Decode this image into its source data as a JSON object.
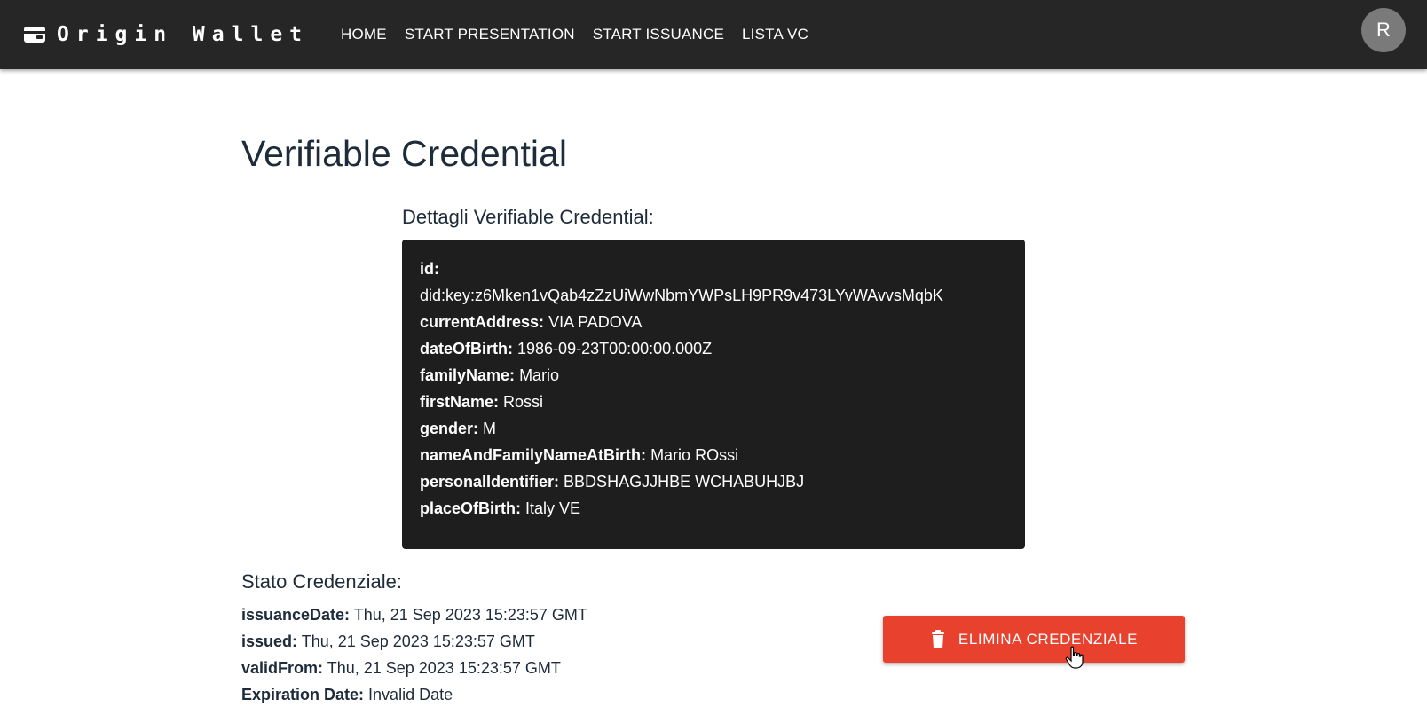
{
  "app": {
    "title": "Origin Wallet",
    "avatar_initial": "R"
  },
  "nav": {
    "items": [
      {
        "label": "HOME"
      },
      {
        "label": "START PRESENTATION"
      },
      {
        "label": "START ISSUANCE"
      },
      {
        "label": "LISTA VC"
      }
    ]
  },
  "page": {
    "title": "Verifiable Credential",
    "details_title": "Dettagli Verifiable Credential:"
  },
  "credential": {
    "id_label": "id:",
    "id_value": "did:key:z6Mken1vQab4zZzUiWwNbmYWPsLH9PR9v473LYvWAvvsMqbK",
    "fields": [
      {
        "label": "currentAddress:",
        "value": "VIA PADOVA"
      },
      {
        "label": "dateOfBirth:",
        "value": "1986-09-23T00:00:00.000Z"
      },
      {
        "label": "familyName:",
        "value": "Mario"
      },
      {
        "label": "firstName:",
        "value": "Rossi"
      },
      {
        "label": "gender:",
        "value": "M"
      },
      {
        "label": "nameAndFamilyNameAtBirth:",
        "value": "Mario ROssi"
      },
      {
        "label": "personalIdentifier:",
        "value": "BBDSHAGJJHBE WCHABUHJBJ"
      },
      {
        "label": "placeOfBirth:",
        "value": "Italy VE"
      }
    ]
  },
  "status": {
    "title": "Stato Credenziale:",
    "fields": [
      {
        "label": "issuanceDate:",
        "value": "Thu, 21 Sep 2023 15:23:57 GMT"
      },
      {
        "label": "issued:",
        "value": "Thu, 21 Sep 2023 15:23:57 GMT"
      },
      {
        "label": "validFrom:",
        "value": "Thu, 21 Sep 2023 15:23:57 GMT"
      },
      {
        "label": "Expiration Date:",
        "value": "Invalid Date"
      }
    ]
  },
  "actions": {
    "delete_label": "ELIMINA CREDENZIALE",
    "delete_icon": "trash-icon",
    "delete_color": "#e8412e"
  },
  "colors": {
    "appbar": "#262626",
    "card": "#1e1e1e",
    "heading": "#1d2b3a"
  }
}
